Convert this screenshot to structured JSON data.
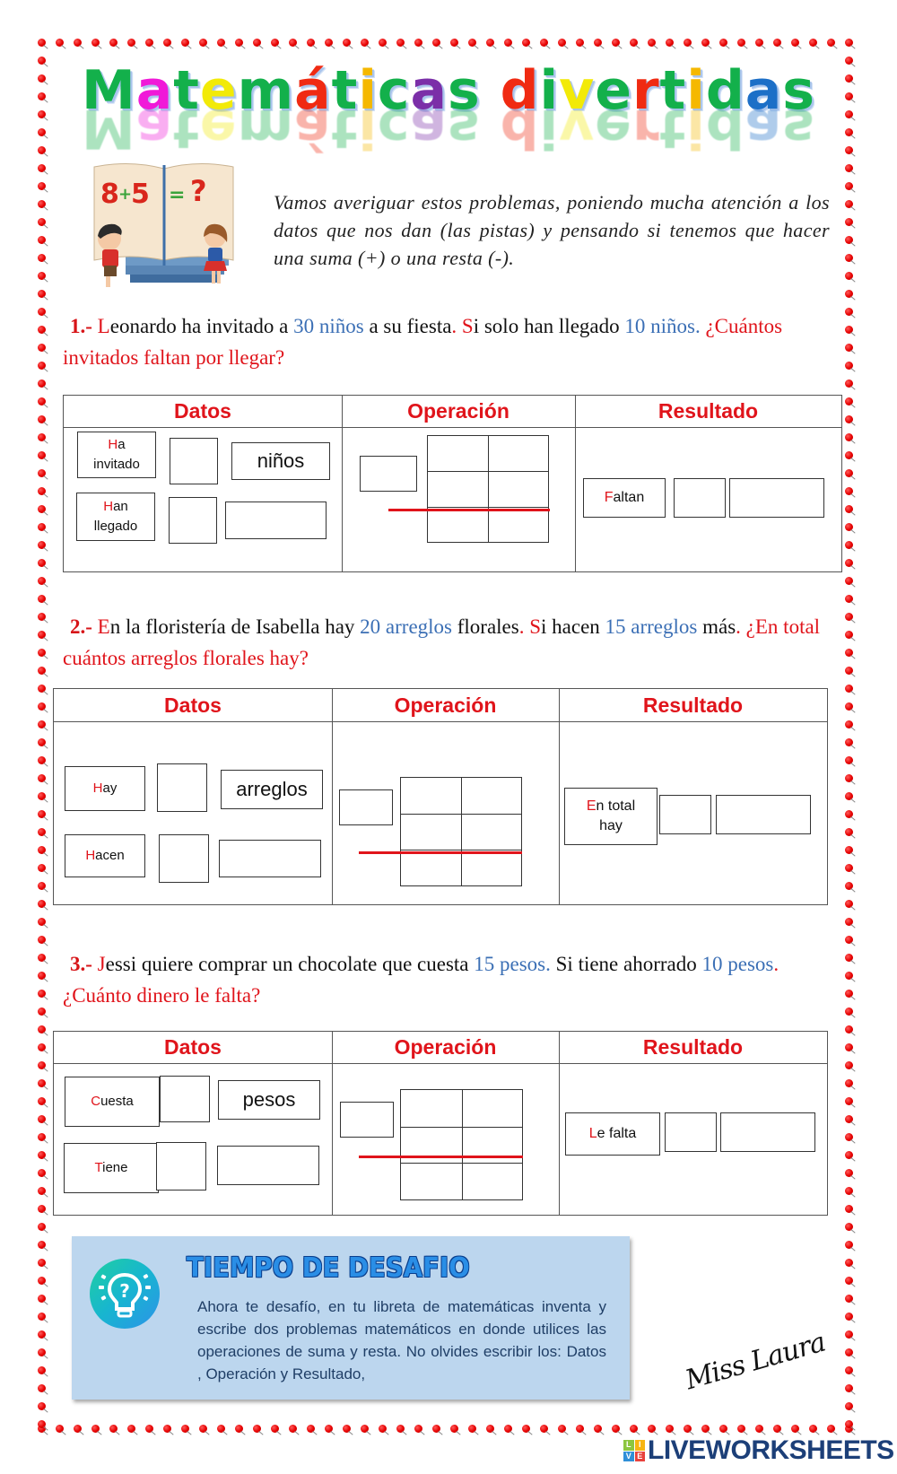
{
  "title": {
    "text": "Matemáticas divertidas",
    "letters": [
      {
        "ch": "M",
        "color": "#13b04b"
      },
      {
        "ch": "a",
        "color": "#f019d8"
      },
      {
        "ch": "t",
        "color": "#13b04b"
      },
      {
        "ch": "e",
        "color": "#f2ea08"
      },
      {
        "ch": "m",
        "color": "#13b04b"
      },
      {
        "ch": "á",
        "color": "#f02a12"
      },
      {
        "ch": "t",
        "color": "#13b04b"
      },
      {
        "ch": "i",
        "color": "#f5b800"
      },
      {
        "ch": "c",
        "color": "#13b04b"
      },
      {
        "ch": "a",
        "color": "#7b2fa8"
      },
      {
        "ch": "s",
        "color": "#13b04b"
      },
      {
        "ch": " ",
        "color": "#13b04b"
      },
      {
        "ch": "d",
        "color": "#f02a12"
      },
      {
        "ch": "i",
        "color": "#13b04b"
      },
      {
        "ch": "v",
        "color": "#f2ea08"
      },
      {
        "ch": "e",
        "color": "#13b04b"
      },
      {
        "ch": "r",
        "color": "#f02a12"
      },
      {
        "ch": "t",
        "color": "#13b04b"
      },
      {
        "ch": "i",
        "color": "#f5b800"
      },
      {
        "ch": "d",
        "color": "#13b04b"
      },
      {
        "ch": "a",
        "color": "#1c6fc7"
      },
      {
        "ch": "s",
        "color": "#13b04b"
      }
    ]
  },
  "illustration": {
    "equation_left": "8",
    "equation_plus": "+",
    "equation_right": "5",
    "equation_equals": "=",
    "equation_result": "?"
  },
  "intro": "Vamos averiguar estos problemas, poniendo mucha atención a los datos que nos dan (las pistas) y pensando si tenemos que hacer una suma (+) o una resta (-).",
  "table_headers": {
    "datos": "Datos",
    "operacion": "Operación",
    "resultado": "Resultado"
  },
  "problems": [
    {
      "number": "1.-",
      "segments": [
        {
          "text": "L",
          "style": "red"
        },
        {
          "text": "eonardo ha invitado a ",
          "style": "plain"
        },
        {
          "text": "30 niños",
          "style": "blue"
        },
        {
          "text": " a su fiesta",
          "style": "plain"
        },
        {
          "text": ". S",
          "style": "red"
        },
        {
          "text": "i solo han llegado ",
          "style": "plain"
        },
        {
          "text": "10 niños.",
          "style": "blue"
        },
        {
          "text": " ¿Cuántos invitados faltan por llegar?",
          "style": "red"
        }
      ],
      "datos": [
        {
          "label_first": "H",
          "label_rest": "a",
          "label_line2": "invitado",
          "unit": "niños"
        },
        {
          "label_first": "H",
          "label_rest": "an",
          "label_line2": "llegado",
          "unit": ""
        }
      ],
      "resultado": {
        "label_first": "F",
        "label_rest": "altan",
        "label_line2": ""
      }
    },
    {
      "number": "2.-",
      "segments": [
        {
          "text": "E",
          "style": "red"
        },
        {
          "text": "n la floristería de Isabella hay ",
          "style": "plain"
        },
        {
          "text": "20 arreglos",
          "style": "blue"
        },
        {
          "text": " florales",
          "style": "plain"
        },
        {
          "text": ". S",
          "style": "red"
        },
        {
          "text": "i hacen ",
          "style": "plain"
        },
        {
          "text": "15 arreglos",
          "style": "blue"
        },
        {
          "text": " más",
          "style": "plain"
        },
        {
          "text": ". ¿En total cuántos arreglos florales hay?",
          "style": "red"
        }
      ],
      "datos": [
        {
          "label_first": "H",
          "label_rest": "ay",
          "label_line2": "",
          "unit": "arreglos"
        },
        {
          "label_first": "H",
          "label_rest": "acen",
          "label_line2": "",
          "unit": ""
        }
      ],
      "resultado": {
        "label_first": "E",
        "label_rest": "n total",
        "label_line2": "hay"
      }
    },
    {
      "number": "3.-",
      "segments": [
        {
          "text": "J",
          "style": "red"
        },
        {
          "text": "essi quiere comprar un chocolate que cuesta ",
          "style": "plain"
        },
        {
          "text": "15 pesos.",
          "style": "blue"
        },
        {
          "text": " Si tiene ahorrado ",
          "style": "plain"
        },
        {
          "text": "10 pesos",
          "style": "blue"
        },
        {
          "text": ". ¿Cuánto dinero le falta?",
          "style": "red"
        }
      ],
      "datos": [
        {
          "label_first": "C",
          "label_rest": "uesta",
          "label_line2": "",
          "unit": "pesos"
        },
        {
          "label_first": "T",
          "label_rest": "iene",
          "label_line2": "",
          "unit": ""
        }
      ],
      "resultado": {
        "label_first": "L",
        "label_rest": "e falta",
        "label_line2": ""
      }
    }
  ],
  "challenge": {
    "title": "TIEMPO DE DESAFIO",
    "icon": "lightbulb-question-icon",
    "text": "Ahora te desafío, en tu libreta de matemáticas inventa y escribe dos problemas matemáticos en donde utilices las operaciones de suma y resta.  No olvides escribir los: Datos , Operación y Resultado,"
  },
  "signature": "Miss Laura",
  "brand": {
    "text": "LIVEWORKSHEETS",
    "logo_letters": [
      "L",
      "I",
      "V",
      "E"
    ],
    "logo_colors": [
      "#8cc63f",
      "#f7b512",
      "#2f8fd8",
      "#e8413c"
    ]
  },
  "colors": {
    "accent_red": "#e0141b",
    "accent_blue": "#3b6fb5",
    "pin_red": "#e60000",
    "challenge_bg": "#bcd6ee"
  }
}
